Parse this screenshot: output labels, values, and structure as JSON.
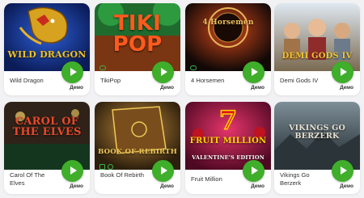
{
  "demo_label": "Демо",
  "games": [
    {
      "name": "Wild Dragon",
      "art_title": "WILD DRAGON",
      "colors": [
        "#1b3fa8",
        "#0c1f63"
      ],
      "accent": "#f4c21a"
    },
    {
      "name": "TikiPop",
      "art_title": "TIKI POP",
      "colors": [
        "#1f8a3b",
        "#9e3b12"
      ],
      "accent": "#ff5a1e"
    },
    {
      "name": "4 Horsemen",
      "art_title": "4 Horsemen",
      "colors": [
        "#3b1e12",
        "#0f0b0a"
      ],
      "accent": "#f0c060"
    },
    {
      "name": "Demi Gods IV",
      "art_title": "DEMI GODS IV",
      "colors": [
        "#b9c9d9",
        "#6a5d48"
      ],
      "accent": "#f2c431"
    },
    {
      "name": "Carol Of The Elves",
      "art_title": "CAROL OF THE ELVES",
      "colors": [
        "#3b2a1c",
        "#143a22"
      ],
      "accent": "#e74a2c"
    },
    {
      "name": "Book Of Rebirth",
      "art_title": "BOOK OF REBIRTH",
      "colors": [
        "#6b4a1e",
        "#2d1f0d"
      ],
      "accent": "#f0c858"
    },
    {
      "name": "Fruit Million",
      "art_title": "FRUIT MILLION",
      "art_subtitle": "VALENTINE'S EDITION",
      "colors": [
        "#c71a4f",
        "#5b0b2a"
      ],
      "accent": "#ffd400"
    },
    {
      "name": "Vikings Go Berzerk",
      "art_title": "VIKINGS GO BERZERK",
      "colors": [
        "#5a6f7d",
        "#1e2a30"
      ],
      "accent": "#e8e1d2"
    }
  ]
}
